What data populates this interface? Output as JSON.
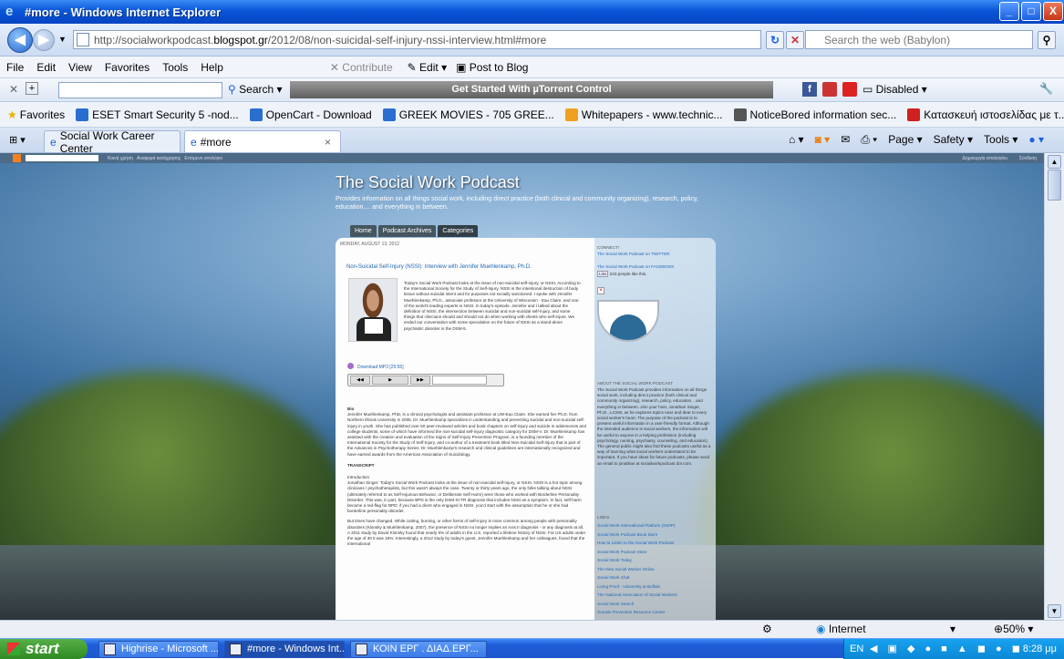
{
  "window": {
    "title": "#more - Windows Internet Explorer",
    "minimize": "_",
    "maximize": "□",
    "close": "X"
  },
  "addressbar": {
    "url_prefix": "http://socialworkpodcast.",
    "url_domain": "blogspot.gr",
    "url_path": "/2012/08/non-suicidal-self-injury-nssi-interview.html#more",
    "search_placeholder": "Search the web (Babylon)"
  },
  "menu": [
    "File",
    "Edit",
    "View",
    "Favorites",
    "Tools",
    "Help"
  ],
  "toolbar": {
    "contribute": "Contribute",
    "edit": "Edit",
    "post_to_blog": "Post to Blog",
    "search_label": "Search",
    "utorrent": "Get Started With µTorrent Control",
    "disabled": "Disabled"
  },
  "favorites": {
    "label": "Favorites",
    "items": [
      {
        "label": "ESET Smart Security 5 -nod...",
        "color": "#2a6fd0"
      },
      {
        "label": "OpenCart - Download",
        "color": "#2a6fd0"
      },
      {
        "label": "GREEK MOVIES - 705 GREE...",
        "color": "#2a6fd0"
      },
      {
        "label": "Whitepapers - www.technic...",
        "color": "#f0a020"
      },
      {
        "label": "NoticeBored information sec...",
        "color": "#555555"
      },
      {
        "label": "Κατασκευή ιστοσελίδας με τ...",
        "color": "#d02020"
      }
    ]
  },
  "tabs": [
    {
      "label": "Social Work Career Center"
    },
    {
      "label": "#more",
      "active": true
    }
  ],
  "tab_close": "×",
  "commands": [
    "Page ▾",
    "Safety ▾",
    "Tools ▾"
  ],
  "blog": {
    "title": "The Social Work Podcast",
    "description": "Provides information on all things social work, including direct practice (both clinical and community organizing), research, policy, education.... and everything in between.",
    "nav": [
      "Home",
      "Podcast Archives",
      "Categories"
    ],
    "date": "MONDAY, AUGUST 13, 2012",
    "post_title": "Non-Suicidal Self-Injury (NSSI): Interview with Jennifer Muehlenkamp, Ph.D.",
    "intro": "Today's Social Work Podcast looks at the issue of non-suicidal self-injury, or NSSI. According to the International Society for the Study of Self-Injury, NSSI is the intentional destruction of body tissue without suicidal intent and for purposes not socially sanctioned. I spoke with Jennifer Muehlenkamp, Ph.D., associate professor at the University of Wisconsin - Eau Claire, and one of the world's leading experts in NSSI. In today's episode, Jennifer and I talked about the definition of NSSI, the intersection between suicidal and non-suicidal self-injury, and some things that clinicians should and should not do when working with clients who self-injure. We ended our conversation with some speculation on the future of NSSI as a stand-alone psychiatric disorder in the DSM-5.",
    "download": "Download MP3 [25:55]",
    "bio_heading": "Bio",
    "bio": "Jennifer Muehlenkamp, PhD, is a clinical psychologist and assistant professor at UW-Eau Claire. She earned her Ph.D. from Northern Illinois University in 2005. Dr. Muehlenkamp specializes in understanding and preventing suicidal and non-suicidal self-injury in youth. She has published over 60 peer-reviewed articles and book chapters on self-injury and suicide in adolescents and college students, some of which have informed the non-suicidal self-injury diagnostic category for DSM-V. Dr. Muehlenkamp has assisted with the creation and evaluation of the Signs of Self-Injury Prevention Program, is a founding member of the International Society for the Study of Self-Injury, and co-author of a treatment book titled Non-Suicidal Self-Injury that is part of the Advances in Psychotherapy Series. Dr. Muehlenkamp's research and clinical guidelines are internationally recognized and have earned awards from the American Association of Suicidology.",
    "transcript_heading": "TRANSCRIPT",
    "intro_heading": "Introduction",
    "transcript1": "Jonathan Singer: Today's Social Work Podcast looks at the issue of non-suicidal self-injury, or NSSI. NSSI is a hot topic among clinicians / psychotherapists, but this wasn't always the case. Twenty or thirty years ago, the only folks talking about NSSI (ultimately referred to as Self-Injurious Behavior, or Deliberate Self Harm) were those who worked with Borderline Personality Disorder. This was, in part, because BPD is the only DSM-IV-TR diagnosis that includes NSSI as a symptom. In fact, self-harm became a red-flag for BPD; if you had a client who engaged in NSSI, you'd start with the assumption that he or she had borderline personality disorder.",
    "transcript2": "But times have changed. While cutting, burning, or other forms of self-injury is more common among people with personality disorders (Klonsky & Muehlenkamp, 2007), the presence of NSSI no longer implies an Axis II diagnosis - or any diagnosis at all. A 2011 study by David Klonsky found that nearly 6% of adults in the U.S. reported a lifetime history of NSSI. For US adults under the age of 30 it was 19%. Interestingly, a 2012 study by today's guest, Jennifer Muehlenkamp and her colleagues, found that the international"
  },
  "sidebar": {
    "connect_heading": "CONNECT!",
    "twitter": "The Social Work Podcast on TWITTER",
    "facebook": "The Social Work Podcast on FACEBOOK",
    "like": "Like",
    "likes_count": "243 people like this.",
    "about_heading": "ABOUT THE SOCIAL WORK PODCAST",
    "about": "The Social Work Podcast provides information on all things social work, including direct practice (both clinical and community organizing), research, policy, education... and everything in between. Join your host, Jonathan Singer, Ph.D., LCSW, as he explores topics near and dear to every social worker's heart. The purpose of the podcast is to present useful information in a user-friendly format. Although the intended audience is social workers, the information will be useful to anyone in a helping profession (including psychology, nursing, psychiatry, counseling, and education). The general public might also find these podcasts useful as a way of learning what social workers understand to be important. If you have ideas for future podcasts, please send an email to jonathan at socialworkpodcast dot com.",
    "links_heading": "LINKS",
    "links": [
      "Social Work International Platform (SWIP)",
      "Social Work Podcast Book Store",
      "How to Listen to the Social Work Podcast",
      "Social Work Podcast Store",
      "Social Work Today",
      "The New Social Worker Online",
      "Social Work Chat",
      "Living Proof - University at Buffalo",
      "The National Association of Social Workers",
      "Social Work Search",
      "Suicide Prevention Resource Center"
    ]
  },
  "blogger_bar": [
    "Κοινή χρήση",
    "Αναφορά κατάχρησης",
    "Επόμενο ιστολόγιο"
  ],
  "blogger_right": [
    "Δημιουργία ιστολογίου",
    "Σύνδεση"
  ],
  "status": {
    "zone": "Internet",
    "zoom": "50%"
  },
  "taskbar": {
    "start": "start",
    "tasks": [
      {
        "label": "Highrise - Microsoft ..."
      },
      {
        "label": "#more - Windows Int...",
        "active": true
      },
      {
        "label": "ΚΟΙΝ ΕΡΓ . ΔΙΑΔ.ΕΡΓ..."
      }
    ],
    "lang": "EN",
    "clock": "8:28 μμ"
  }
}
